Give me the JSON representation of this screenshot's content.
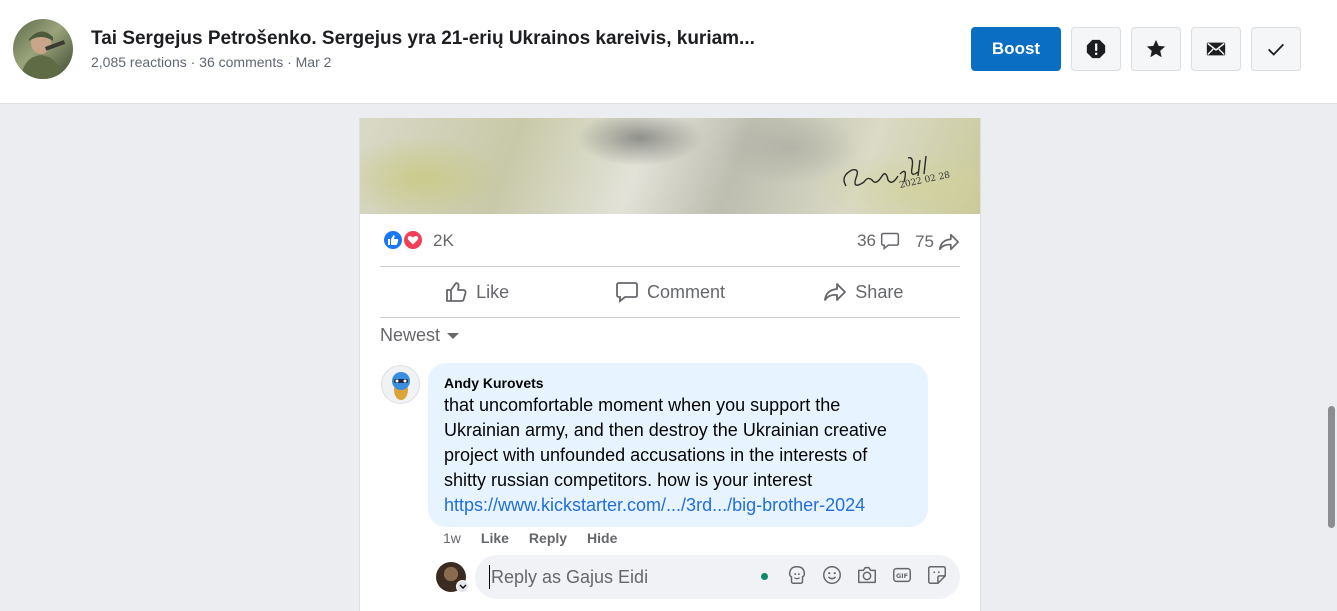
{
  "header": {
    "title": "Tai Sergejus Petrošenko. Sergejus yra 21-erių Ukrainos kareivis, kuriam...",
    "meta": "2,085 reactions · 36 comments · Mar 2",
    "boost_label": "Boost",
    "icons": [
      "alert-icon",
      "star-icon",
      "mail-icon",
      "check-icon"
    ]
  },
  "post": {
    "signature_text": "Gajus Eidi",
    "signature_date": "2022 02 28",
    "reactions_count": "2K",
    "comments_count": "36",
    "shares_count": "75",
    "actions": {
      "like": "Like",
      "comment": "Comment",
      "share": "Share"
    },
    "sort_label": "Newest"
  },
  "comment": {
    "author": "Andy Kurovets",
    "text": "that uncomfortable moment when you support the Ukrainian army, and then destroy the Ukrainian creative project with unfounded accusations in the interests of shitty russian competitors. how is your interest ",
    "link": "https://www.kickstarter.com/.../3rd.../big-brother-2024",
    "time": "1w",
    "like": "Like",
    "reply": "Reply",
    "hide": "Hide"
  },
  "reply": {
    "placeholder": "Reply as Gajus Eidi"
  },
  "colors": {
    "boost": "#0a6fc2",
    "bubble": "#e7f3ff",
    "link": "#216fdb",
    "like_blue": "#1877f2",
    "love_red": "#f33e58"
  }
}
